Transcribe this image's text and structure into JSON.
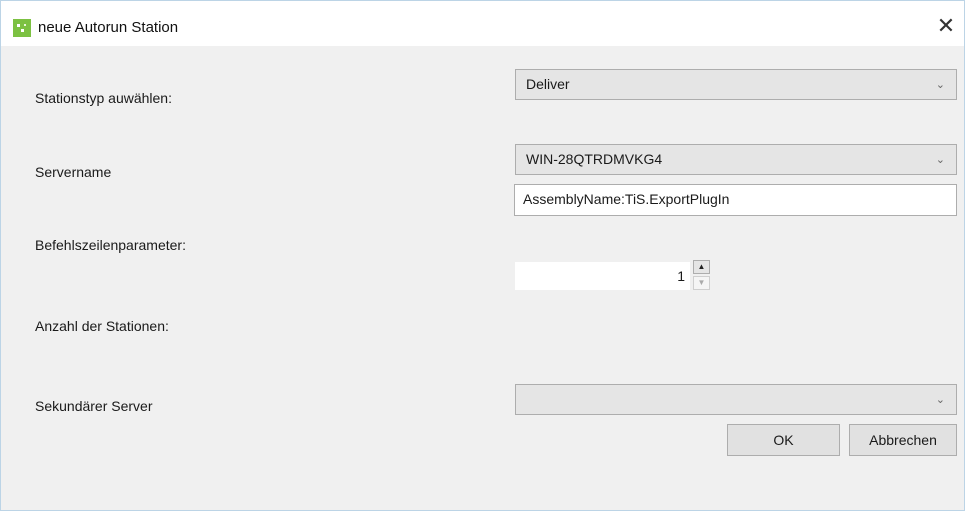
{
  "window": {
    "title": "neue  Autorun Station",
    "close_glyph": "✕",
    "icon": "app-icon"
  },
  "form": {
    "station_type": {
      "label": "Stationstyp auwählen:",
      "value": "Deliver",
      "arrow": "⌄"
    },
    "server_name": {
      "label": "Servername",
      "value": "WIN-28QTRDMVKG4",
      "arrow": "⌄"
    },
    "command_line": {
      "label": "Befehlszeilenparameter:",
      "value": "AssemblyName:TiS.ExportPlugIn"
    },
    "station_count": {
      "label": "Anzahl der Stationen:",
      "value": "1",
      "up_glyph": "▲",
      "down_glyph": "▼"
    },
    "secondary_server": {
      "label": "Sekundärer Server",
      "value": "",
      "arrow": "⌄"
    }
  },
  "buttons": {
    "ok": "OK",
    "cancel": "Abbrechen"
  }
}
